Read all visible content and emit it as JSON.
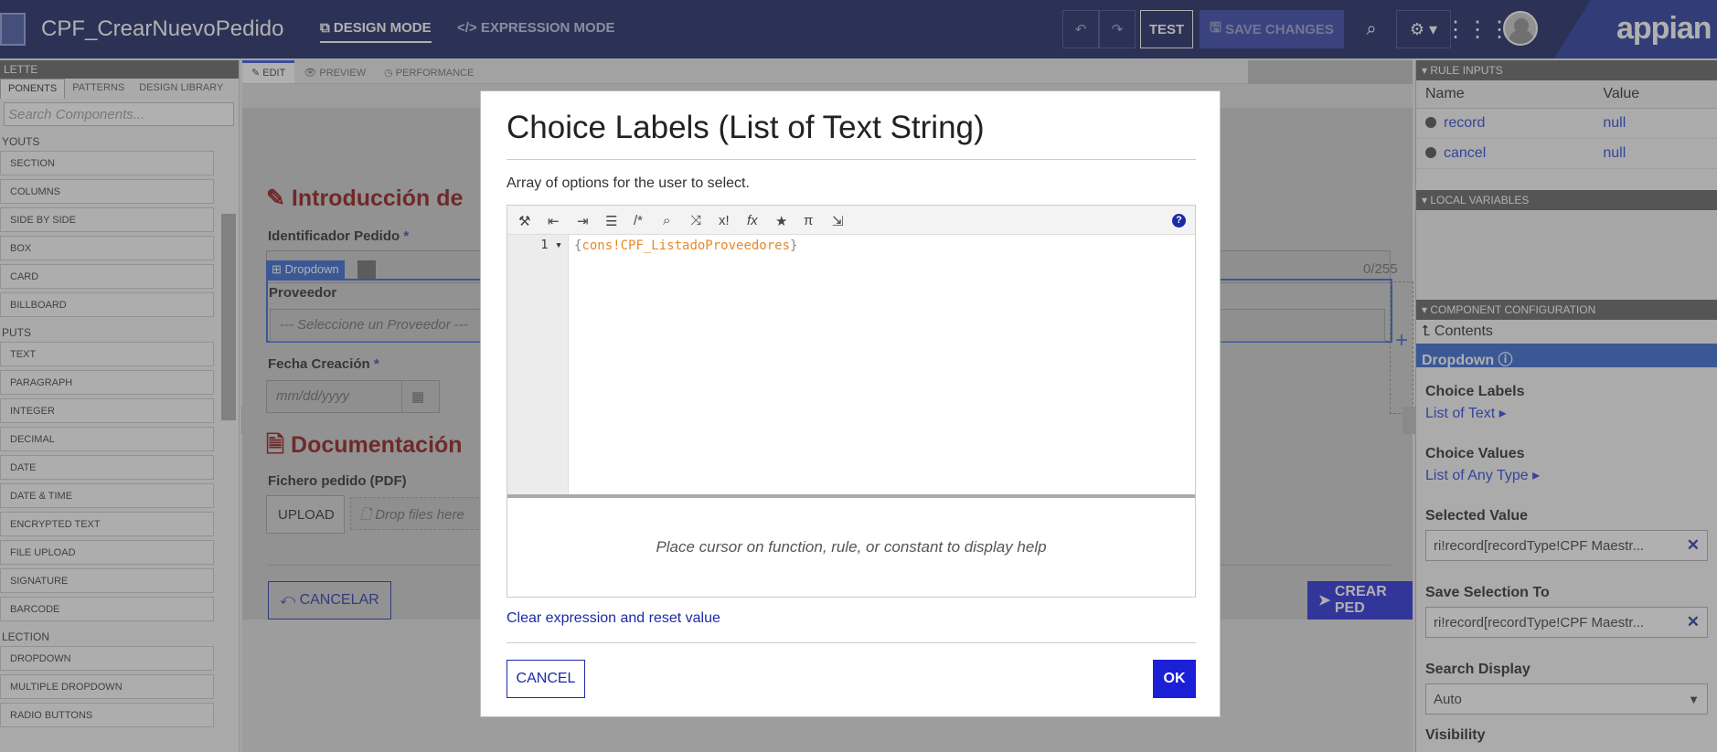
{
  "topbar": {
    "app_title": "CPF_CrearNuevoPedido",
    "design_mode": "DESIGN MODE",
    "expression_mode": "EXPRESSION MODE",
    "test_label": "TEST",
    "save_label": "SAVE CHANGES",
    "brand": "appian"
  },
  "palette": {
    "header": "LETTE",
    "tabs": [
      "PONENTS",
      "PATTERNS",
      "DESIGN LIBRARY"
    ],
    "search_placeholder": "Search Components...",
    "sections": [
      {
        "name": "YOUTS",
        "items": [
          "SECTION",
          "COLUMNS",
          "SIDE BY SIDE",
          "BOX",
          "CARD",
          "BILLBOARD"
        ]
      },
      {
        "name": "PUTS",
        "items": [
          "TEXT",
          "PARAGRAPH",
          "INTEGER",
          "DECIMAL",
          "DATE",
          "DATE & TIME",
          "ENCRYPTED TEXT",
          "FILE UPLOAD",
          "SIGNATURE",
          "BARCODE"
        ]
      },
      {
        "name": "LECTION",
        "items": [
          "DROPDOWN",
          "MULTIPLE DROPDOWN",
          "RADIO BUTTONS"
        ]
      }
    ]
  },
  "canvas": {
    "tabs": [
      "EDIT",
      "PREVIEW",
      "PERFORMANCE"
    ],
    "section1": "Introducción de",
    "id_label": "Identificador Pedido",
    "char_count": "0/255",
    "dropdown_tag": "Dropdown",
    "proveedor_label": "Proveedor",
    "proveedor_placeholder": "--- Seleccione un Proveedor ---",
    "fecha_label": "Fecha Creación",
    "fecha_placeholder": "mm/dd/yyyy",
    "section2": "Documentación",
    "fichero_label": "Fichero pedido (PDF)",
    "upload_label": "UPLOAD",
    "drop_placeholder": "Drop files here",
    "cancel_label": "CANCELAR",
    "create_label": "CREAR PED",
    "required_mark": "*"
  },
  "right": {
    "rule_inputs_header": "RULE INPUTS",
    "col_name": "Name",
    "col_value": "Value",
    "inputs": [
      {
        "name": "record",
        "value": "null"
      },
      {
        "name": "cancel",
        "value": "null"
      }
    ],
    "local_vars_header": "LOCAL VARIABLES",
    "component_config_header": "COMPONENT CONFIGURATION",
    "contents": "Contents",
    "component": "Dropdown",
    "choice_labels": "Choice Labels",
    "choice_labels_link": "List of Text",
    "choice_values": "Choice Values",
    "choice_values_link": "List of Any Type",
    "selected_value": "Selected Value",
    "selected_value_text": "ri!record[recordType!CPF Maestr...",
    "save_selection": "Save Selection To",
    "save_selection_text": "ri!record[recordType!CPF Maestr...",
    "search_display": "Search Display",
    "search_display_value": "Auto",
    "visibility": "Visibility"
  },
  "modal": {
    "title": "Choice Labels (List of Text String)",
    "description": "Array of options for the user to select.",
    "line_number": "1",
    "code_open": "{",
    "code_token": "cons!CPF_ListadoProveedores",
    "code_close": "}",
    "help_text": "Place cursor on function, rule, or constant to display help",
    "clear_link": "Clear expression and reset value",
    "cancel_label": "CANCEL",
    "ok_label": "OK"
  },
  "colors": {
    "topbar": "#0d1a5c",
    "primary": "#1b1fd6",
    "section_heading": "#8a0a0a",
    "code_token": "#e8872a"
  }
}
